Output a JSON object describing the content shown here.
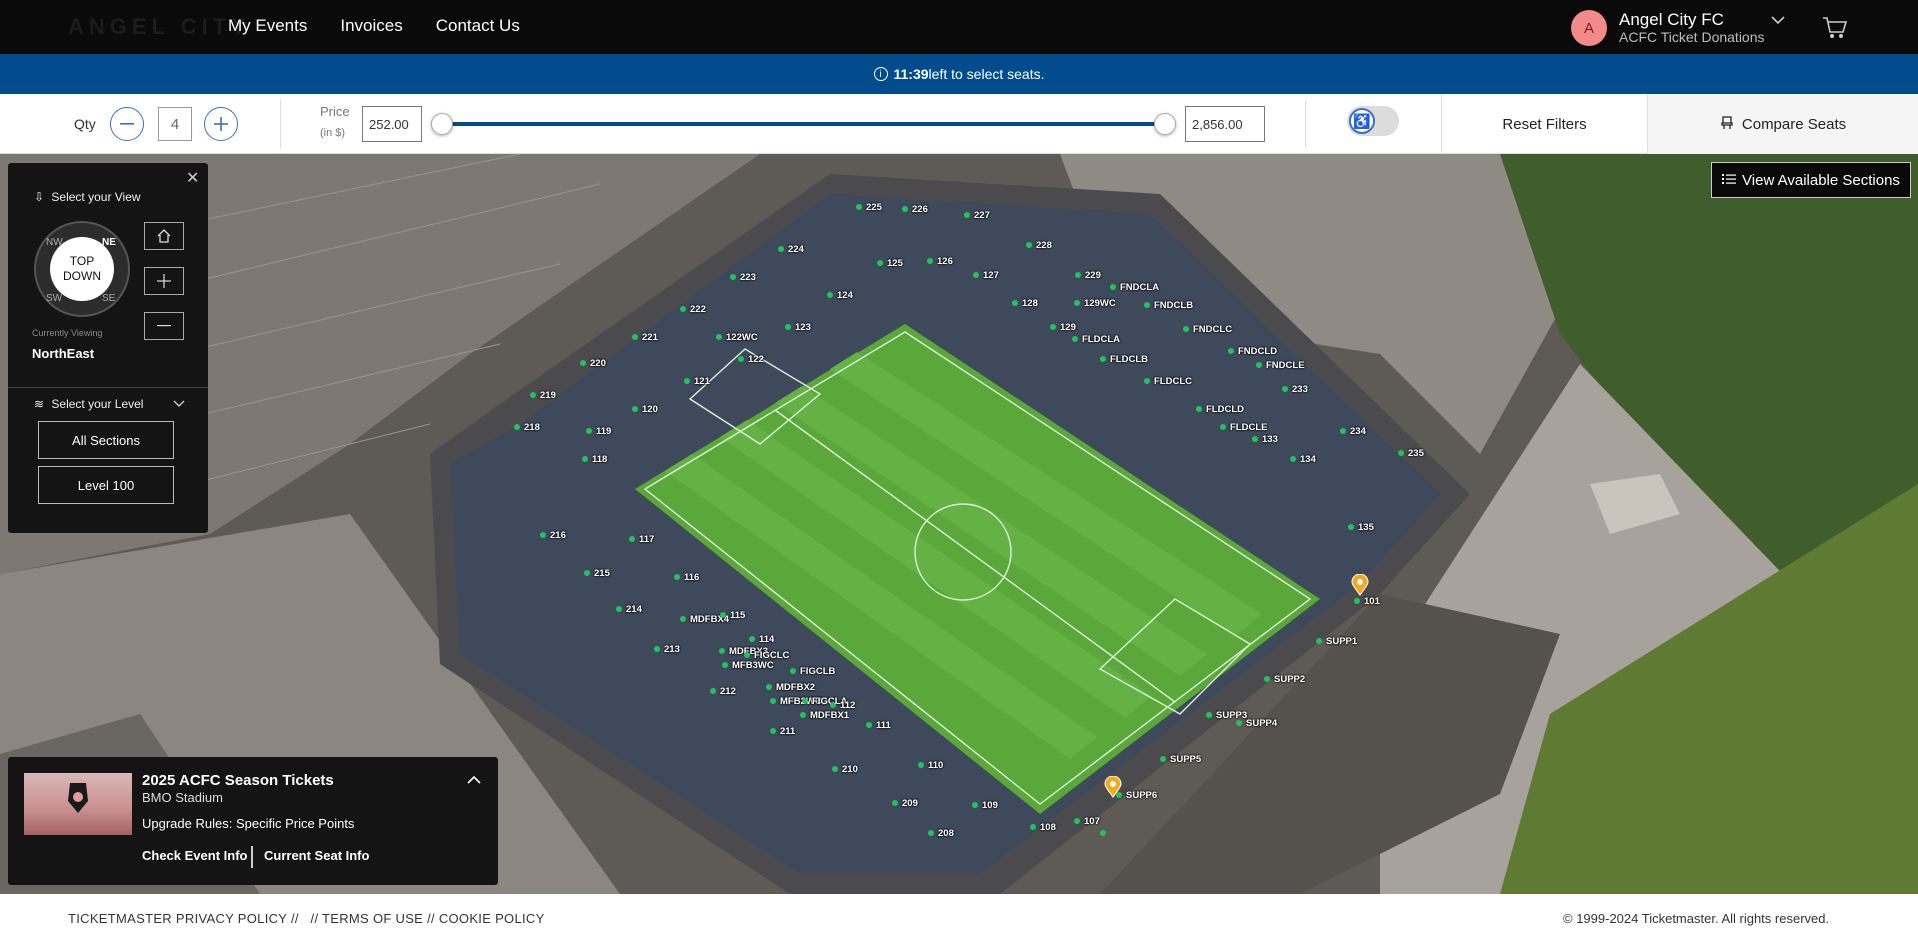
{
  "nav": {
    "logo": "ANGEL CITY",
    "links": [
      "My Events",
      "Invoices",
      "Contact Us"
    ],
    "account": {
      "initial": "A",
      "name": "Angel City FC",
      "subtitle": "ACFC Ticket Donations"
    }
  },
  "timer": {
    "time": "11:39",
    "message": " left to select seats."
  },
  "filters": {
    "qty_label": "Qty",
    "qty_value": "4",
    "price_label": "Price",
    "price_unit": "(in $)",
    "price_min": "252.00",
    "price_max": "2,856.00",
    "reset_label": "Reset Filters",
    "compare_label": "Compare Seats"
  },
  "map": {
    "view_sections_label": "View Available Sections",
    "sections": [
      "225",
      "226",
      "227",
      "224",
      "228",
      "125",
      "126",
      "127",
      "229",
      "FNDCLA",
      "223",
      "124",
      "128",
      "129WC",
      "FNDCLB",
      "222",
      "122WC",
      "123",
      "129",
      "FNDCLC",
      "221",
      "FLDCLA",
      "FNDCLD",
      "220",
      "122",
      "FLDCLB",
      "FNDCLE",
      "121",
      "FLDCLC",
      "219",
      "233",
      "120",
      "FLDCLD",
      "218",
      "119",
      "FLDCLE",
      "133",
      "234",
      "118",
      "134",
      "235",
      "216",
      "117",
      "135",
      "215",
      "116",
      "101",
      "214",
      "MDFBX4",
      "115",
      "SUPP1",
      "213",
      "114",
      "MDFBX3",
      "FIGCLC",
      "MFB3WC",
      "FIGCLB",
      "SUPP2",
      "212",
      "MDFBX2",
      "MFB2WC",
      "FIGCLA",
      "112",
      "MDFBX1",
      "SUPP3",
      "SUPP4",
      "211",
      "111",
      "SUPP5",
      "210",
      "110",
      "SUPP6",
      "209",
      "109",
      "208",
      "108",
      "107"
    ]
  },
  "view_panel": {
    "title": "Select your View",
    "compass_center": "TOP DOWN",
    "compass_dirs": [
      "NW",
      "NE",
      "SW",
      "SE"
    ],
    "currently_viewing_label": "Currently Viewing",
    "currently_viewing": "NorthEast",
    "level_title": "Select your Level",
    "level_options": [
      "All Sections",
      "Level 100"
    ]
  },
  "event": {
    "title": "2025 ACFC Season Tickets",
    "venue": "BMO Stadium",
    "rules": "Upgrade Rules: Specific Price Points",
    "link_event": "Check Event Info",
    "link_seat": "Current Seat Info"
  },
  "footer": {
    "privacy": "TICKETMASTER PRIVACY POLICY",
    "terms": "TERMS OF USE",
    "cookie": "COOKIE POLICY",
    "copyright": "© 1999-2024 Ticketmaster. All rights reserved."
  },
  "colors": {
    "nav_bg": "#0a0a0a",
    "timer_bg": "#024b8d",
    "accent": "#3b6ec7",
    "pitch": "#5aa83a",
    "available": "#21c35a"
  }
}
